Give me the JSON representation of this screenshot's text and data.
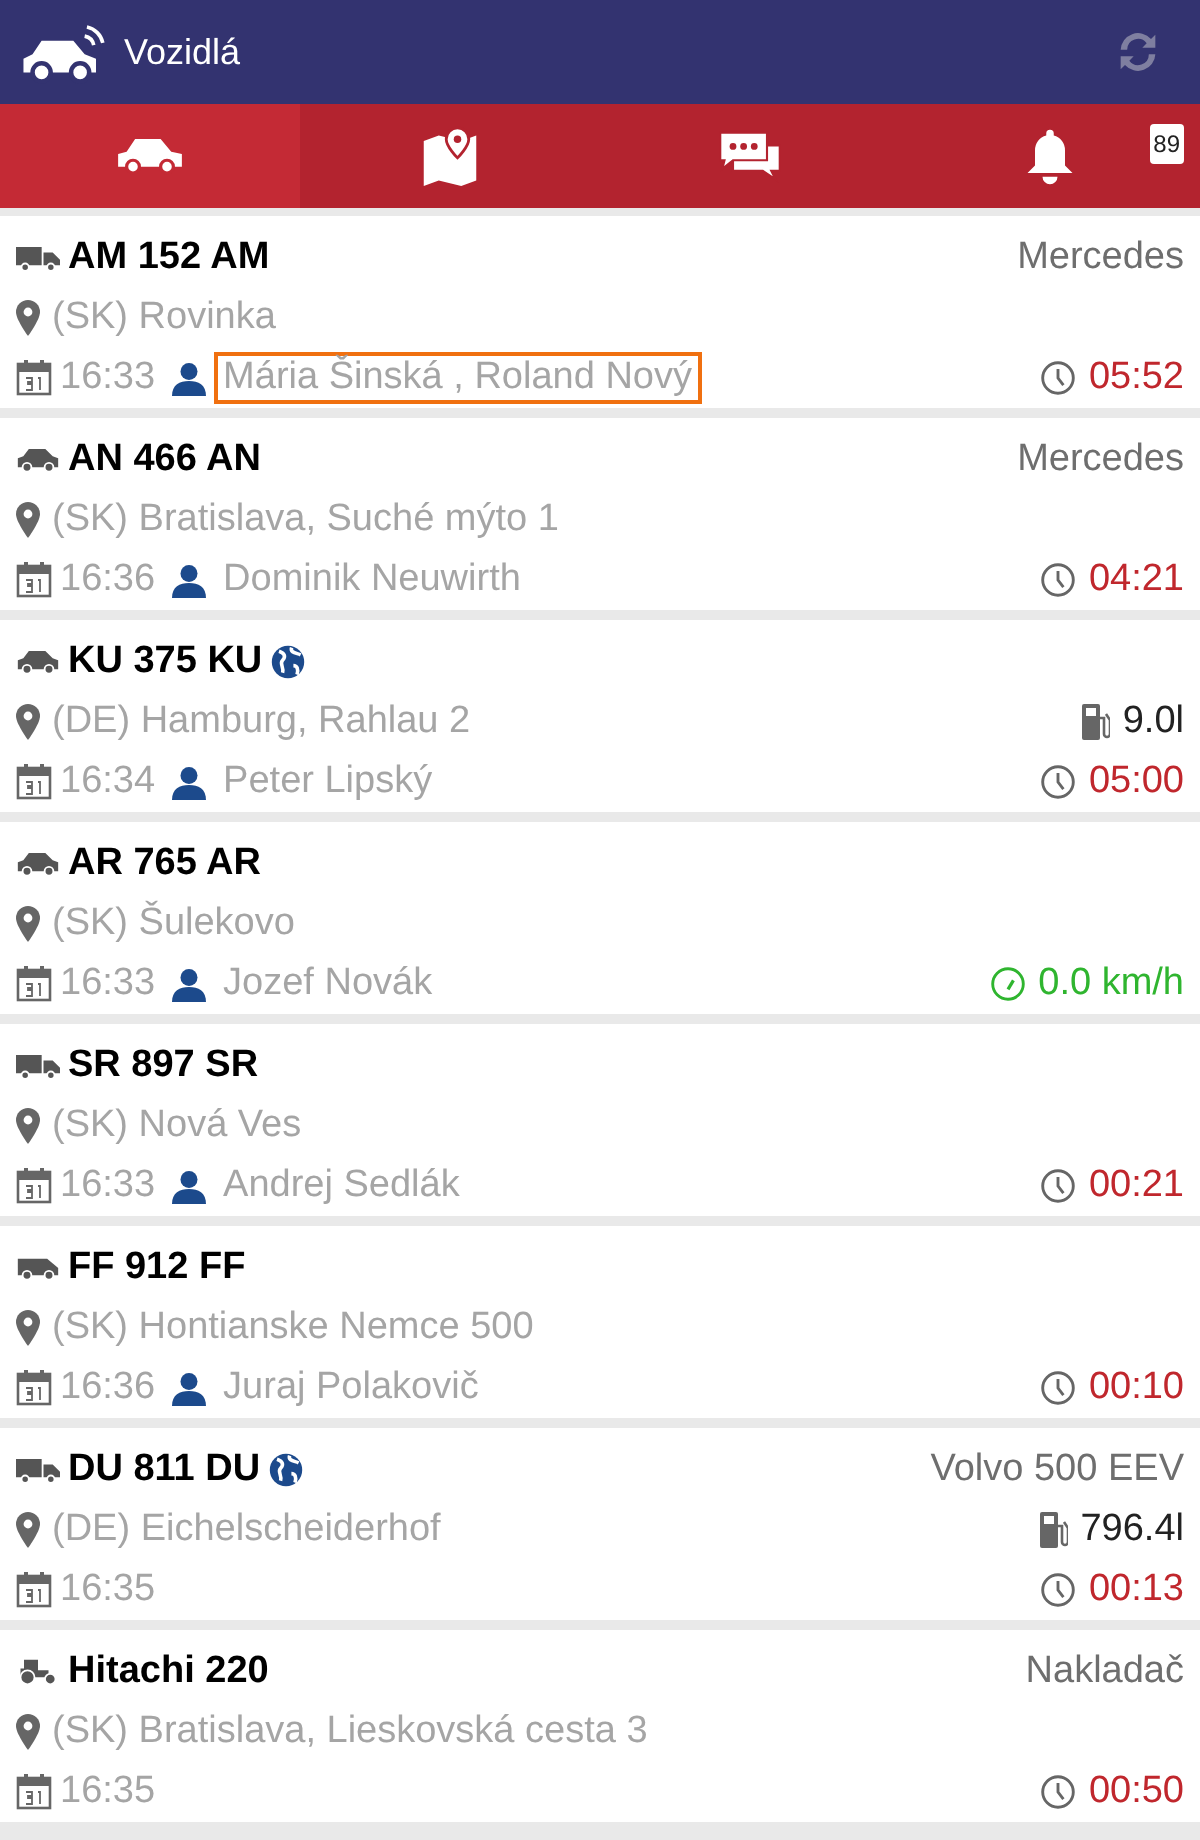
{
  "header": {
    "title": "Vozidlá"
  },
  "tabs": [
    {
      "kind": "vehicles",
      "selected": true
    },
    {
      "kind": "map",
      "selected": false
    },
    {
      "kind": "messages",
      "selected": false
    },
    {
      "kind": "alerts",
      "selected": false,
      "badge": "89"
    }
  ],
  "vehicles": [
    {
      "kind": "truck",
      "plate": "AM 152 AM",
      "international": false,
      "brand": "Mercedes",
      "location": "(SK) Rovinka",
      "time": "16:33",
      "driver": {
        "name": "Mária Šinská , Roland Nový",
        "highlighted": true
      },
      "status": {
        "kind": "duration",
        "text": "05:52"
      }
    },
    {
      "kind": "car",
      "plate": "AN 466 AN",
      "international": false,
      "brand": "Mercedes",
      "location": "(SK) Bratislava, Suché mýto 1",
      "time": "16:36",
      "driver": {
        "name": "Dominik Neuwirth",
        "highlighted": false
      },
      "status": {
        "kind": "duration",
        "text": "04:21"
      }
    },
    {
      "kind": "car",
      "plate": "KU 375 KU",
      "international": true,
      "location": "(DE) Hamburg, Rahlau 2",
      "fuel": "9.0l",
      "time": "16:34",
      "driver": {
        "name": "Peter Lipský",
        "highlighted": false
      },
      "status": {
        "kind": "duration",
        "text": "05:00"
      }
    },
    {
      "kind": "car",
      "plate": "AR 765 AR",
      "international": false,
      "location": "(SK) Šulekovo",
      "time": "16:33",
      "driver": {
        "name": "Jozef Novák",
        "highlighted": false
      },
      "status": {
        "kind": "speed",
        "text": "0.0 km/h"
      }
    },
    {
      "kind": "truck",
      "plate": "SR 897 SR",
      "international": false,
      "location": "(SK) Nová Ves",
      "time": "16:33",
      "driver": {
        "name": "Andrej Sedlák",
        "highlighted": false
      },
      "status": {
        "kind": "duration",
        "text": "00:21"
      }
    },
    {
      "kind": "van",
      "plate": "FF 912 FF",
      "international": false,
      "location": "(SK) Hontianske Nemce 500",
      "time": "16:36",
      "driver": {
        "name": "Juraj Polakovič",
        "highlighted": false
      },
      "status": {
        "kind": "duration",
        "text": "00:10"
      }
    },
    {
      "kind": "truck",
      "plate": "DU 811 DU",
      "international": true,
      "brand": "Volvo 500 EEV",
      "location": "(DE) Eichelscheiderhof",
      "fuel": "796.4l",
      "time": "16:35",
      "status": {
        "kind": "duration",
        "text": "00:13"
      }
    },
    {
      "kind": "tractor",
      "plate": "Hitachi 220",
      "international": false,
      "brand": "Nakladač",
      "location": "(SK) Bratislava, Lieskovská cesta 3",
      "time": "16:35",
      "status": {
        "kind": "duration",
        "text": "00:50"
      }
    }
  ]
}
